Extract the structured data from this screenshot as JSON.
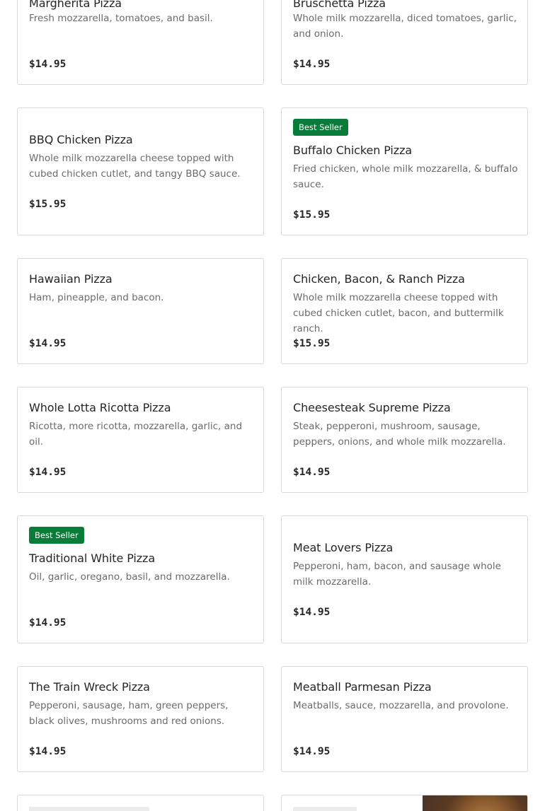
{
  "menu": {
    "items": [
      {
        "name": "Margherita Pizza",
        "desc": "Fresh mozzarella, tomatoes, and basil.",
        "price": "$14.95",
        "badge": ""
      },
      {
        "name": "Bruschetta Pizza",
        "desc": "Whole milk mozzarella, diced tomatoes, garlic, and onion.",
        "price": "$14.95",
        "badge": ""
      },
      {
        "name": "BBQ Chicken Pizza",
        "desc": "Whole milk mozzarella cheese topped with cubed chicken cutlet, and tangy BBQ sauce.",
        "price": "$15.95",
        "badge": ""
      },
      {
        "name": "Buffalo Chicken Pizza",
        "desc": "Fried chicken, whole milk mozzarella, & buffalo sauce.",
        "price": "$15.95",
        "badge": "Best Seller"
      },
      {
        "name": "Hawaiian Pizza",
        "desc": "Ham, pineapple, and bacon.",
        "price": "$14.95",
        "badge": ""
      },
      {
        "name": "Chicken, Bacon, & Ranch Pizza",
        "desc": "Whole milk mozzarella cheese topped with cubed chicken cutlet, bacon, and buttermilk ranch.",
        "price": "$15.95",
        "badge": ""
      },
      {
        "name": "Whole Lotta Ricotta Pizza",
        "desc": "Ricotta, more ricotta, mozzarella, garlic, and oil.",
        "price": "$14.95",
        "badge": ""
      },
      {
        "name": "Cheesesteak Supreme Pizza",
        "desc": "Steak, pepperoni, mushroom, sausage, peppers, onions, and whole milk mozzarella.",
        "price": "$14.95",
        "badge": ""
      },
      {
        "name": "Traditional White Pizza",
        "desc": "Oil, garlic, oregano, basil, and mozzarella.",
        "price": "$14.95",
        "badge": "Best Seller"
      },
      {
        "name": "Meat Lovers Pizza",
        "desc": "Pepperoni, ham, bacon, and sausage whole milk mozzarella.",
        "price": "$14.95",
        "badge": ""
      },
      {
        "name": "The Train Wreck Pizza",
        "desc": "Pepperoni, sausage, ham, green peppers, black olives, mushrooms and red onions.",
        "price": "$14.95",
        "badge": ""
      },
      {
        "name": "Meatball Parmesan Pizza",
        "desc": "Meatballs, sauce, mozzarella, and provolone.",
        "price": "$14.95",
        "badge": ""
      }
    ]
  },
  "colors": {
    "badge_bg": "#0a7c3a",
    "text": "#262626",
    "muted": "#6b6b6b",
    "border": "#d9d9d9"
  }
}
